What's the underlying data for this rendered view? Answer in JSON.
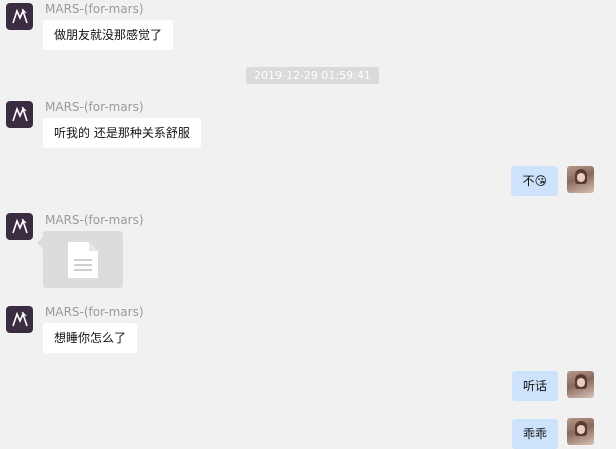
{
  "messages": {
    "m1": {
      "sender": "MARS-(for-mars)",
      "text": "做朋友就没那感觉了"
    },
    "timestamp": "2019-12-29 01:59:41",
    "m2": {
      "sender": "MARS-(for-mars)",
      "text": "听我的 还是那种关系舒服"
    },
    "m3": {
      "text": "不😘"
    },
    "m4": {
      "sender": "MARS-(for-mars)",
      "attachment_icon": "document-icon"
    },
    "m5": {
      "sender": "MARS-(for-mars)",
      "text": "想睡你怎么了"
    },
    "m6": {
      "text": "听话"
    },
    "m7": {
      "text": "乖乖"
    }
  },
  "colors": {
    "background": "#f1f1f1",
    "incoming_bubble": "#ffffff",
    "outgoing_bubble": "#cde3fb",
    "sender_text": "#9a9a9a",
    "timestamp_bg": "#dadada"
  }
}
